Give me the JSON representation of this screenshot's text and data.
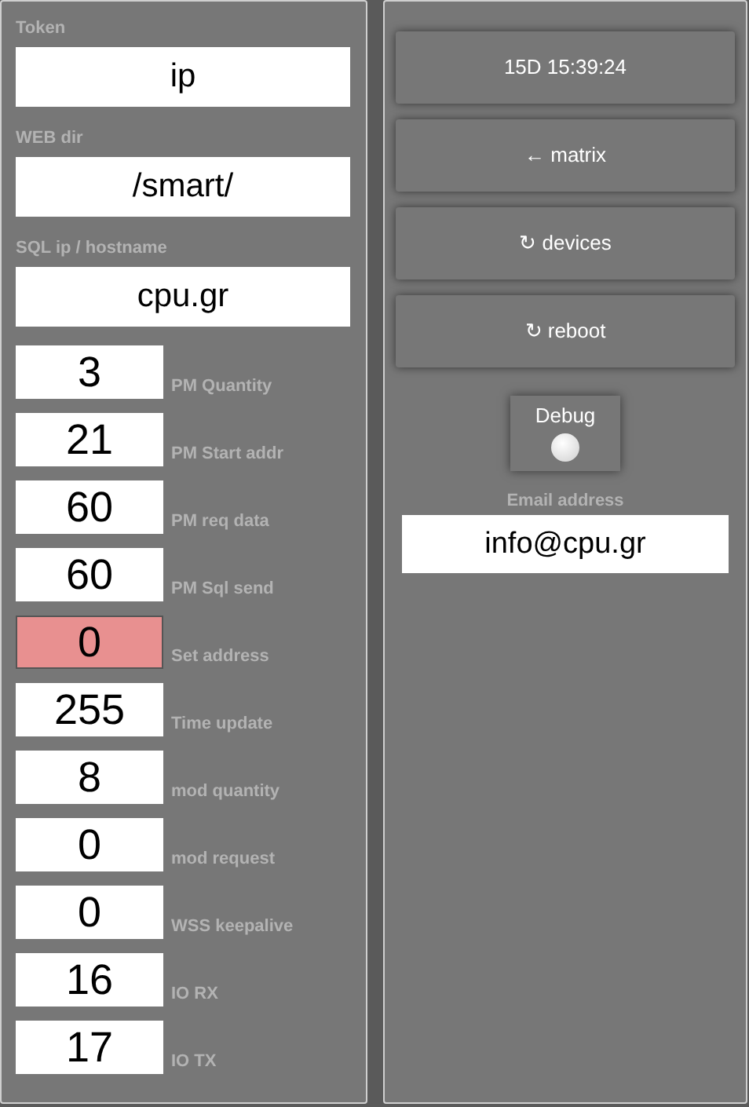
{
  "settings": [
    {
      "label": "Token",
      "value": "ip"
    },
    {
      "label": "WEB dir",
      "value": "/smart/"
    },
    {
      "label": "SQL ip / hostname",
      "value": "cpu.gr"
    }
  ],
  "numbers": [
    {
      "label": "PM Quantity",
      "value": "3",
      "alert": false
    },
    {
      "label": "PM Start addr",
      "value": "21",
      "alert": false
    },
    {
      "label": "PM req data",
      "value": "60",
      "alert": false
    },
    {
      "label": "PM Sql send",
      "value": "60",
      "alert": false
    },
    {
      "label": "Set address",
      "value": "0",
      "alert": true
    },
    {
      "label": "Time update",
      "value": "255",
      "alert": false
    },
    {
      "label": "mod quantity",
      "value": "8",
      "alert": false
    },
    {
      "label": "mod request",
      "value": "0",
      "alert": false
    },
    {
      "label": "WSS keepalive",
      "value": "0",
      "alert": false
    },
    {
      "label": "IO RX",
      "value": "16",
      "alert": false
    },
    {
      "label": "IO TX",
      "value": "17",
      "alert": false
    }
  ],
  "buttons": [
    "15D 15:39:24",
    "← matrix",
    "↻ devices",
    "↻ reboot"
  ],
  "debug": {
    "label": "Debug",
    "on": false
  },
  "email": {
    "label": "Email address",
    "value": "info@cpu.gr"
  }
}
